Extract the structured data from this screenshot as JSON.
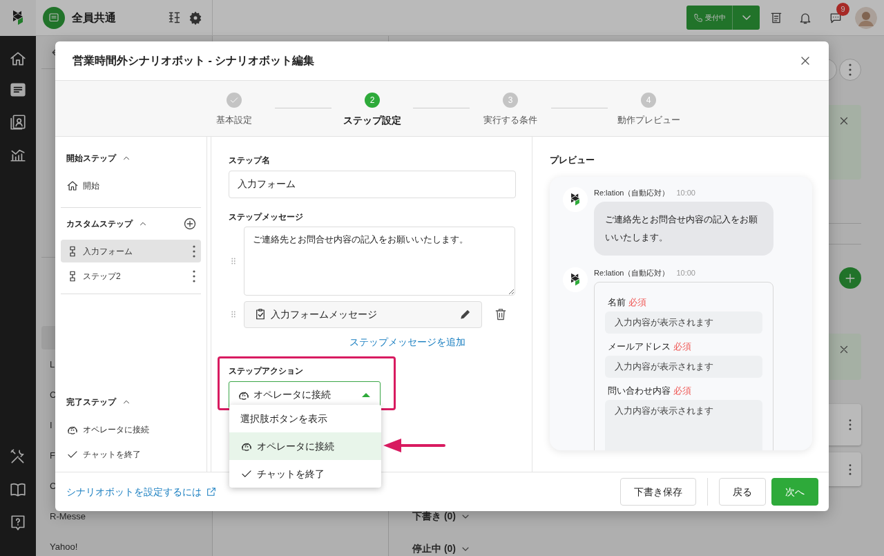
{
  "topbar": {
    "workspace": "全員共通",
    "status_button": "受付中",
    "chat_badge": "9"
  },
  "bg_sidebar": {
    "items": [
      {
        "selected": true
      },
      {
        "label": "L",
        "selected": false
      },
      {
        "label": "C",
        "selected": false
      },
      {
        "label": "I",
        "selected": false
      },
      {
        "label": "F",
        "selected": false
      },
      {
        "label": "C",
        "selected": false
      },
      {
        "label": "R-Messe",
        "selected": false
      },
      {
        "label": "Yahoo!",
        "selected": false
      }
    ]
  },
  "bg_main": {
    "groups": [
      {
        "label": "下書き (0)",
        "expanded": false
      },
      {
        "label": "停止中 (0)",
        "expanded": false
      }
    ]
  },
  "modal": {
    "title": "営業時間外シナリオボット - シナリオボット編集",
    "steps": [
      {
        "label": "基本設定",
        "done": true,
        "selected": false
      },
      {
        "number": "2",
        "label": "ステップ設定",
        "done": false,
        "selected": true
      },
      {
        "number": "3",
        "label": "実行する条件",
        "done": false,
        "selected": false
      },
      {
        "number": "4",
        "label": "動作プレビュー",
        "done": false,
        "selected": false
      }
    ],
    "step_sections": [
      {
        "heading": "開始ステップ",
        "expanded": true,
        "items": [
          {
            "label": "開始",
            "kind": "start",
            "selected": false
          }
        ]
      },
      {
        "heading": "カスタムステップ",
        "expanded": true,
        "addable": true,
        "items": [
          {
            "label": "入力フォーム",
            "kind": "custom",
            "selected": true
          },
          {
            "label": "ステップ2",
            "kind": "custom",
            "selected": false
          }
        ]
      },
      {
        "heading": "完了ステップ",
        "expanded": true,
        "items": [
          {
            "label": "オペレータに接続",
            "kind": "operator",
            "selected": false
          },
          {
            "label": "チャットを終了",
            "kind": "finish",
            "selected": false
          }
        ]
      }
    ],
    "form": {
      "name_label": "ステップ名",
      "name_value": "入力フォーム",
      "message_label": "ステップメッセージ",
      "messages": [
        {
          "kind": "text",
          "value": "ご連絡先とお問合せ内容の記入をお願いいたします。"
        },
        {
          "kind": "form",
          "label": "入力フォームメッセージ"
        }
      ],
      "add_message_link": "ステップメッセージを追加",
      "action_label": "ステップアクション",
      "action": {
        "value": "オペレータに接続",
        "kind": "operator",
        "expanded": true
      },
      "action_options": [
        {
          "label": "選択肢ボタンを表示",
          "kind": "choice",
          "selected": false
        },
        {
          "label": "オペレータに接続",
          "kind": "operator",
          "selected": true
        },
        {
          "label": "チャットを終了",
          "kind": "finish",
          "selected": false
        }
      ]
    },
    "preview": {
      "title": "プレビュー",
      "messages": [
        {
          "kind": "text",
          "sender": "Re:lation（自動応対）",
          "time": "10:00",
          "text": "ご連絡先とお問合せ内容の記入をお願いいたします。"
        },
        {
          "kind": "form",
          "sender": "Re:lation（自動応対）",
          "time": "10:00",
          "fields": [
            {
              "label": "名前",
              "required_tag": "必須",
              "placeholder": "入力内容が表示されます",
              "multiline": false
            },
            {
              "label": "メールアドレス",
              "required_tag": "必須",
              "placeholder": "入力内容が表示されます",
              "multiline": false
            },
            {
              "label": "問い合わせ内容",
              "required_tag": "必須",
              "placeholder": "入力内容が表示されます",
              "multiline": true
            }
          ]
        }
      ]
    },
    "footer": {
      "help_link": "シナリオボットを設定するには",
      "buttons": [
        {
          "label": "下書き保存",
          "kind": "secondary"
        },
        {
          "label": "戻る",
          "kind": "secondary"
        },
        {
          "label": "次へ",
          "kind": "primary"
        }
      ]
    }
  }
}
